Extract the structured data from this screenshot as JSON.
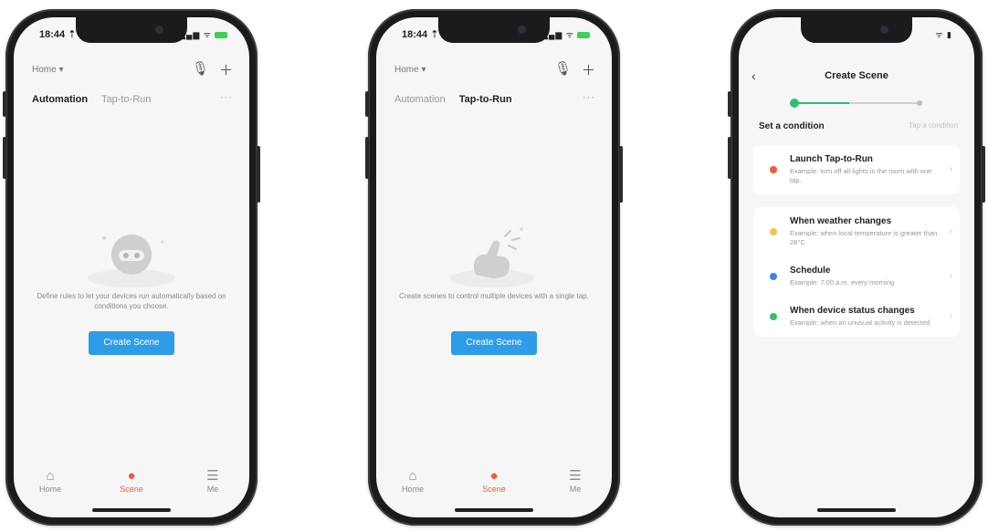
{
  "phones": [
    {
      "status_time": "18:44 ⇡",
      "status_icons": "▂▄▆ ᯤ",
      "home_label": "Home ▾",
      "tabs": [
        "Automation",
        "Tap-to-Run"
      ],
      "active_tab": 0,
      "empty_text": "Define rules to let your devices run automatically based on conditions you choose.",
      "create_button": "Create Scene",
      "nav": [
        "Home",
        "Scene",
        "Me"
      ]
    },
    {
      "status_time": "18:44 ⇡",
      "status_icons": "▂▄▆ ᯤ",
      "home_label": "Home ▾",
      "tabs": [
        "Automation",
        "Tap-to-Run"
      ],
      "active_tab": 1,
      "empty_text": "Create scenes to control multiple devices with a single tap.",
      "create_button": "Create Scene",
      "nav": [
        "Home",
        "Scene",
        "Me"
      ]
    }
  ],
  "create_scene": {
    "status_icons": "ᯤ ▮",
    "title": "Create Scene",
    "progress": 0.45,
    "condition_heading": "Set a condition",
    "condition_hint": "Tap a condition",
    "options": [
      {
        "title": "Launch Tap-to-Run",
        "desc": "Example: turn off all lights in the room with one tap.",
        "color": "#ef5a3c"
      },
      {
        "title": "When weather changes",
        "desc": "Example: when local temperature is greater than 28°C",
        "color": "#f6c344"
      },
      {
        "title": "Schedule",
        "desc": "Example: 7:00 a.m. every morning",
        "color": "#3f7fe8"
      },
      {
        "title": "When device status changes",
        "desc": "Example: when an unusual activity is detected",
        "color": "#2dc06a"
      }
    ]
  }
}
